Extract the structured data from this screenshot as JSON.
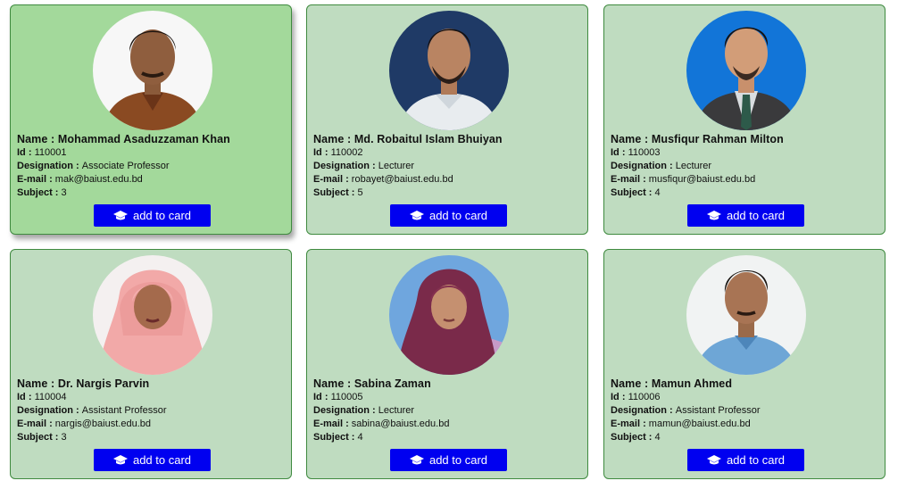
{
  "labels": {
    "name": "Name : ",
    "id": "Id : ",
    "designation": "Designation : ",
    "email": "E-mail : ",
    "subject": "Subject : ",
    "button": "add to card"
  },
  "button_icon": "graduation-cap-icon",
  "colors": {
    "card": "#bfdcc0",
    "card_active": "#a3d99b",
    "button": "#0000f0",
    "border": "#3f8a3f"
  },
  "teachers": [
    {
      "name": "Mohammad Asaduzzaman Khan",
      "id": "110001",
      "designation": "Associate Professor",
      "email": "mak@baiust.edu.bd",
      "subject": "3"
    },
    {
      "name": "Md. Robaitul Islam Bhuiyan",
      "id": "110002",
      "designation": "Lecturer",
      "email": "robayet@baiust.edu.bd",
      "subject": "5"
    },
    {
      "name": "Musfiqur Rahman Milton",
      "id": "110003",
      "designation": "Lecturer",
      "email": "musfiqur@baiust.edu.bd",
      "subject": "4"
    },
    {
      "name": "Dr. Nargis Parvin",
      "id": "110004",
      "designation": "Assistant Professor",
      "email": "nargis@baiust.edu.bd",
      "subject": "3"
    },
    {
      "name": "Sabina Zaman",
      "id": "110005",
      "designation": "Lecturer",
      "email": "sabina@baiust.edu.bd",
      "subject": "4"
    },
    {
      "name": "Mamun Ahmed",
      "id": "110006",
      "designation": "Assistant Professor",
      "email": "mamun@baiust.edu.bd",
      "subject": "4"
    }
  ]
}
